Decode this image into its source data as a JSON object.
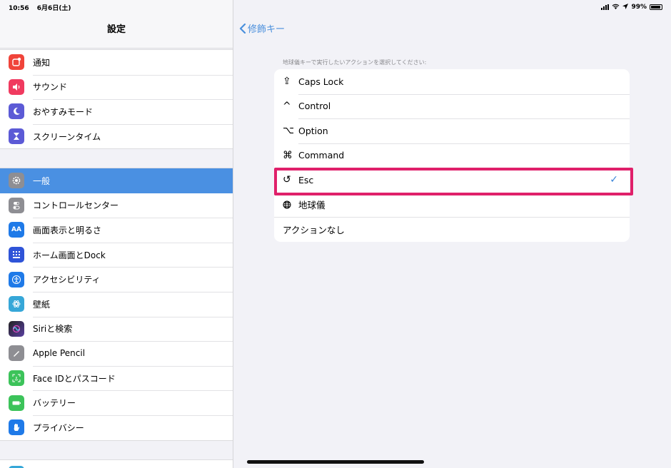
{
  "status": {
    "time": "10:56",
    "date": "6月6日(土)",
    "battery": "99%"
  },
  "sidebar": {
    "title": "設定",
    "groups": [
      {
        "items": [
          {
            "label": "通知",
            "icon": "notifications-icon",
            "color": "#f0443a"
          },
          {
            "label": "サウンド",
            "icon": "sound-icon",
            "color": "#f03a5f"
          },
          {
            "label": "おやすみモード",
            "icon": "moon-icon",
            "color": "#5c5ad6"
          },
          {
            "label": "スクリーンタイム",
            "icon": "hourglass-icon",
            "color": "#5c5ad6"
          }
        ]
      },
      {
        "items": [
          {
            "label": "一般",
            "icon": "gear-icon",
            "color": "#8e8e93",
            "selected": true
          },
          {
            "label": "コントロールセンター",
            "icon": "toggle-icon",
            "color": "#8e8e93"
          },
          {
            "label": "画面表示と明るさ",
            "icon": "text-size-icon",
            "color": "#1f7ae8"
          },
          {
            "label": "ホーム画面とDock",
            "icon": "grid-icon",
            "color": "#2f54d8"
          },
          {
            "label": "アクセシビリティ",
            "icon": "accessibility-icon",
            "color": "#1f7ae8"
          },
          {
            "label": "壁紙",
            "icon": "flower-icon",
            "color": "#36a7d8"
          },
          {
            "label": "Siriと検索",
            "icon": "siri-icon",
            "color": "#222"
          },
          {
            "label": "Apple Pencil",
            "icon": "pencil-icon",
            "color": "#8e8e93"
          },
          {
            "label": "Face IDとパスコード",
            "icon": "face-id-icon",
            "color": "#3cc35a"
          },
          {
            "label": "バッテリー",
            "icon": "battery-icon",
            "color": "#3cc35a"
          },
          {
            "label": "プライバシー",
            "icon": "hand-icon",
            "color": "#1f7ae8"
          }
        ]
      }
    ]
  },
  "main": {
    "back_label": "修飾キー",
    "caption": "地球儀キーで実行したいアクションを選択してください:",
    "options": [
      {
        "label": "Caps Lock",
        "glyph": "⇪"
      },
      {
        "label": "Control",
        "glyph": "^"
      },
      {
        "label": "Option",
        "glyph": "⌥"
      },
      {
        "label": "Command",
        "glyph": "⌘"
      },
      {
        "label": "Esc",
        "glyph": "↺",
        "checked": true
      },
      {
        "label": "地球儀",
        "glyph": "🌐"
      },
      {
        "label": "アクションなし",
        "glyph": ""
      }
    ],
    "check_glyph": "✓",
    "accent": "#3a86d9",
    "highlight_color": "#e0206a"
  }
}
